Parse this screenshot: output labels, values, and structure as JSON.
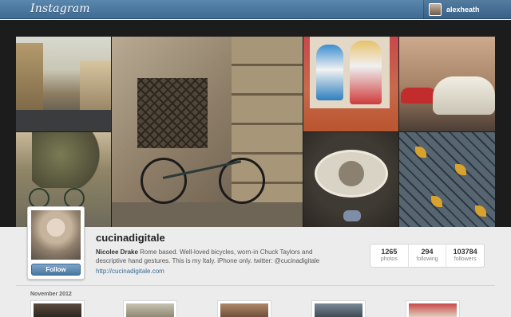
{
  "nav": {
    "logo": "Instagram",
    "user": {
      "name": "alexheath"
    }
  },
  "profile": {
    "username": "cucinadigitale",
    "full_name": "Nicolee Drake",
    "bio": "Rome based. Well-loved bicycles, worn-in Chuck Taylors and descriptive hand gestures. This is my Italy. iPhone only. twitter: @cucinadigitale",
    "website": "http://cucinadigitale.com",
    "follow_label": "Follow"
  },
  "stats": [
    {
      "value": "1265",
      "label": "photos"
    },
    {
      "value": "294",
      "label": "following"
    },
    {
      "value": "103784",
      "label": "followers"
    }
  ],
  "feed": {
    "month": "November 2012"
  },
  "colors": {
    "navbar": "#4b77a1",
    "header_bg": "#1c1c1c",
    "page_bg": "#ececec",
    "link": "#3b6b98"
  }
}
